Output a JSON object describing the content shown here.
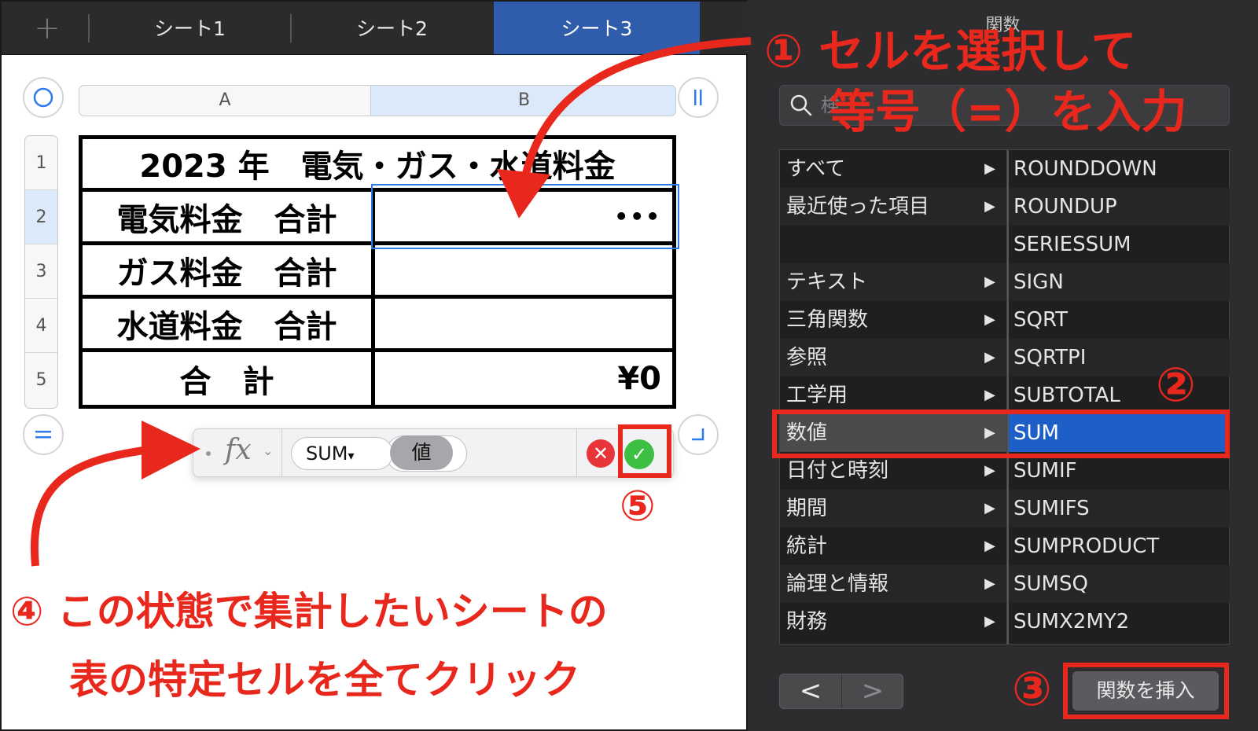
{
  "tabs": {
    "add": "+",
    "items": [
      "シート1",
      "シート2",
      "シート3"
    ],
    "active": 2
  },
  "columns": [
    "A",
    "B"
  ],
  "rows": [
    "1",
    "2",
    "3",
    "4",
    "5"
  ],
  "table": {
    "title": "2023 年　電気・ガス・水道料金",
    "rows": [
      {
        "label": "電気料金　合計",
        "value": "•••"
      },
      {
        "label": "ガス料金　合計",
        "value": ""
      },
      {
        "label": "水道料金　合計",
        "value": ""
      },
      {
        "label": "合　計",
        "value": "¥0"
      }
    ]
  },
  "formula_bar": {
    "fx": "fx",
    "chevron": "⌄",
    "function_token": "SUM",
    "token_arrow": "▾",
    "value_token": "値",
    "cancel": "✕",
    "accept": "✓"
  },
  "panel": {
    "title": "関数",
    "search_placeholder": "検",
    "categories": [
      "すべて",
      "最近使った項目",
      "",
      "テキスト",
      "三角関数",
      "参照",
      "工学用",
      "数値",
      "日付と時刻",
      "期間",
      "統計",
      "論理と情報",
      "財務"
    ],
    "category_arrow": "▶",
    "selected_category": "数値",
    "functions": [
      "ROUNDDOWN",
      "ROUNDUP",
      "SERIESSUM",
      "SIGN",
      "SQRT",
      "SQRTPI",
      "SUBTOTAL",
      "SUM",
      "SUMIF",
      "SUMIFS",
      "SUMPRODUCT",
      "SUMSQ",
      "SUMX2MY2"
    ],
    "selected_function": "SUM",
    "nav_prev": "<",
    "nav_next": ">",
    "insert_button": "関数を挿入"
  },
  "annotations": {
    "step1_line1": "① セルを選択して",
    "step1_line2": "等号（=）を入力",
    "step2": "②",
    "step3": "③",
    "step4_line1": "④ この状態で集計したいシートの",
    "step4_line2": "表の特定セルを全てクリック",
    "step5": "⑤"
  },
  "colors": {
    "annotation_red": "#e8271d",
    "selected_blue": "#1d5fc6",
    "active_tab": "#2f5dab"
  }
}
